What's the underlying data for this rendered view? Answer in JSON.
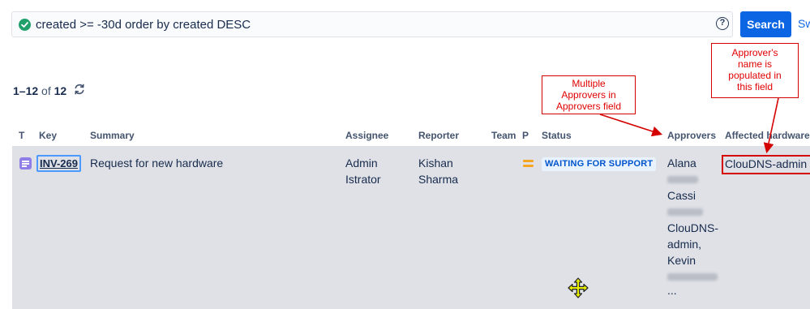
{
  "search": {
    "query": "created >= -30d order by created DESC",
    "button_label": "Search",
    "switch_label": "Sw",
    "help_glyph": "?"
  },
  "results": {
    "range": "1–12",
    "of_label": "of",
    "total": "12"
  },
  "table": {
    "headers": {
      "type": "T",
      "key": "Key",
      "summary": "Summary",
      "assignee": "Assignee",
      "reporter": "Reporter",
      "team": "Team",
      "priority": "P",
      "status": "Status",
      "approvers": "Approvers",
      "affected_hardware": "Affected hardware"
    },
    "rows": [
      {
        "type_icon": "service-request-icon",
        "key": "INV-269",
        "summary": "Request for new hardware",
        "assignee": [
          "Admin",
          "Istrator"
        ],
        "reporter": [
          "Kishan",
          "Sharma"
        ],
        "team": "",
        "priority_icon": "medium-priority-icon",
        "status": "WAITING FOR SUPPORT",
        "approvers": [
          "Alana",
          "Cassi",
          "ClouDNS-",
          "admin,",
          "Kevin",
          "..."
        ],
        "affected_hardware": "ClouDNS-admin"
      }
    ]
  },
  "annotations": {
    "multiple_approvers": [
      "Multiple",
      "Approvers in",
      "Approvers field"
    ],
    "approver_name": [
      "Approver's",
      "name is",
      "populated in",
      "this field"
    ]
  },
  "colors": {
    "primary": "#0c66e4",
    "success": "#22a06b",
    "status_bg": "#e9f2ff",
    "status_text": "#0055cc",
    "annotation_red": "#d40000",
    "row_highlight": "#dfe1e6",
    "priority_medium": "#f5a623"
  }
}
